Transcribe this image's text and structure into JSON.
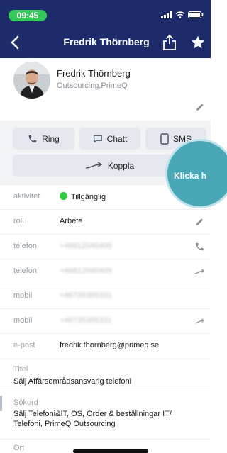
{
  "status": {
    "time": "09:45"
  },
  "nav": {
    "title": "Fredrik Thörnberg"
  },
  "profile": {
    "name": "Fredrik Thörnberg",
    "org": "Outsourcing,PrimeQ"
  },
  "actions": {
    "ring": "Ring",
    "chatt": "Chatt",
    "sms": "SMS",
    "koppla": "Koppla"
  },
  "overlay": {
    "text": "Klicka h"
  },
  "details": [
    {
      "label": "aktivitet",
      "value": "Tillgänglig"
    },
    {
      "label": "roll",
      "value": "Arbete"
    },
    {
      "label": "telefon",
      "value": "+46812040409"
    },
    {
      "label": "telefon",
      "value": "+46812040409"
    },
    {
      "label": "mobil",
      "value": "+46735395331"
    },
    {
      "label": "mobil",
      "value": "+46735395331"
    },
    {
      "label": "e-post",
      "value": "fredrik.thornberg@primeq.se"
    }
  ],
  "title_block": {
    "label": "Titel",
    "value": "Sälj Affärsområdsansvarig telefoni"
  },
  "search_block": {
    "label": "Sökord",
    "value": "Sälj Telefoni&IT, OS, Order & beställningar IT/ Telefoni, PrimeQ Outsourcing"
  },
  "location_block": {
    "label": "Ort"
  },
  "colors": {
    "nav": "#1d2b6b",
    "available": "#2ecc40",
    "overlay": "#4aa7b7",
    "status_pill": "#34c759"
  }
}
